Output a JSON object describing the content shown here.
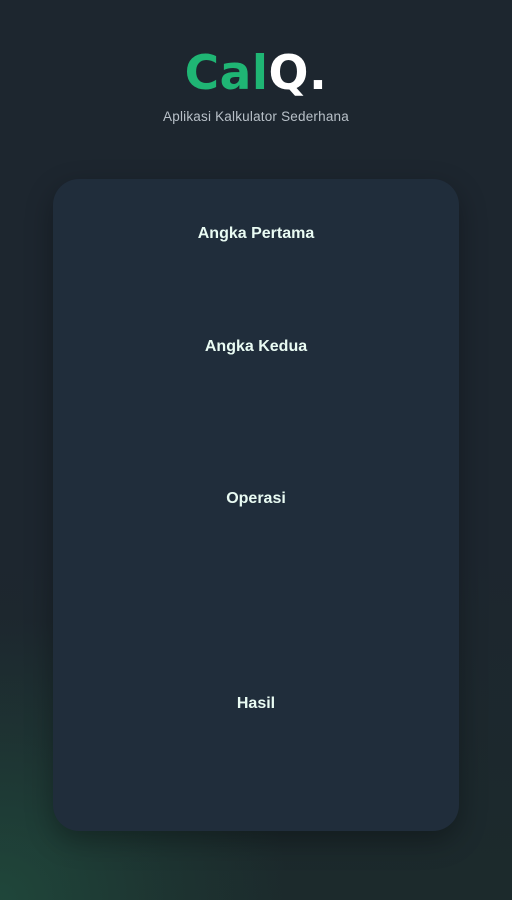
{
  "header": {
    "brand_accent": "Cal",
    "brand_rest": "Q.",
    "subtitle": "Aplikasi Kalkulator Sederhana"
  },
  "form": {
    "first_number_label": "Angka Pertama",
    "second_number_label": "Angka Kedua",
    "operation_label": "Operasi",
    "result_label": "Hasil"
  },
  "colors": {
    "accent": "#1fb574",
    "background": "#1d262f",
    "card": "#202d3b",
    "label_text": "#e9fbf3",
    "subtitle_text": "#b8c0c8"
  }
}
